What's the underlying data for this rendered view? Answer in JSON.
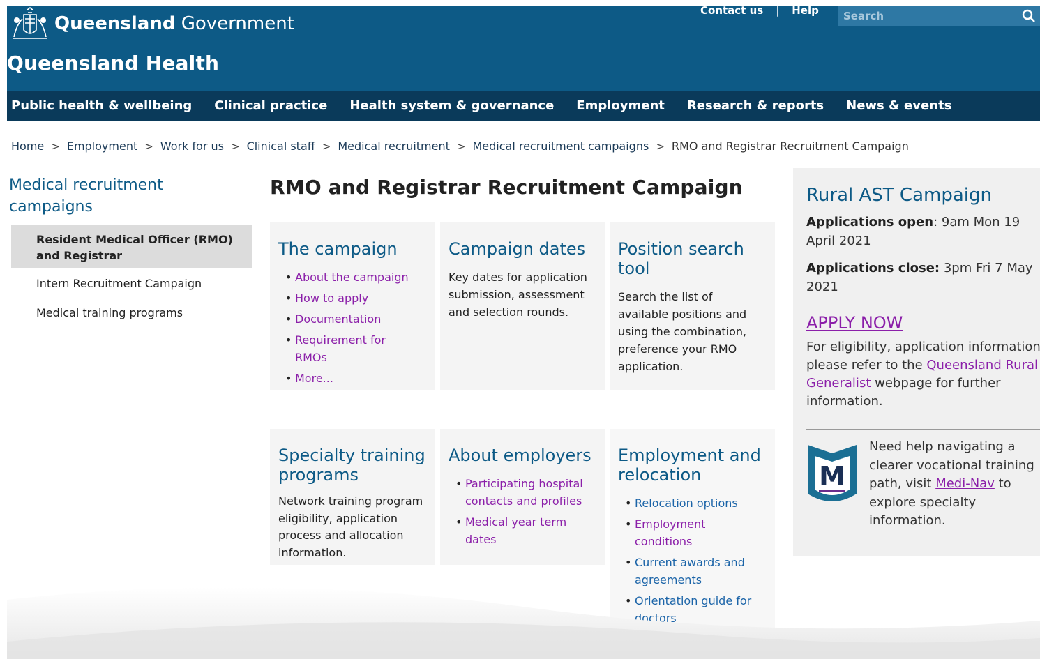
{
  "header": {
    "brand_bold": "Queensland",
    "brand_light": " Government",
    "site_name": "Queensland Health",
    "contact_label": "Contact us",
    "help_label": "Help",
    "search_placeholder": "Search",
    "colors": {
      "header_bg": "#0d5a86",
      "nav_bg": "#0a3a5a"
    }
  },
  "nav": {
    "items": [
      "Public health & wellbeing",
      "Clinical practice",
      "Health system & governance",
      "Employment",
      "Research & reports",
      "News & events"
    ]
  },
  "breadcrumb": {
    "items": [
      "Home",
      "Employment",
      "Work for us",
      "Clinical staff",
      "Medical recruitment",
      "Medical recruitment campaigns"
    ],
    "current": "RMO and Registrar Recruitment Campaign"
  },
  "sidenav": {
    "title": "Medical recruitment campaigns",
    "items": [
      "Resident Medical Officer (RMO) and Registrar",
      "Intern Recruitment Campaign",
      "Medical training programs"
    ]
  },
  "main": {
    "title": "RMO and Registrar Recruitment Campaign",
    "tiles": {
      "campaign": {
        "title": "The campaign",
        "links": [
          "About the campaign",
          "How to apply",
          "Documentation",
          "Requirement for RMOs",
          "More..."
        ]
      },
      "dates": {
        "title": "Campaign dates",
        "text": "Key dates for application submission, assessment and selection rounds."
      },
      "position": {
        "title": "Position search tool",
        "text": "Search the list of available positions and using the combination, preference your RMO application."
      },
      "specialty": {
        "title": "Specialty training programs",
        "text": "Network training program eligibility, application process and allocation information."
      },
      "employers": {
        "title": "About employers",
        "links": [
          "Participating hospital contacts and profiles",
          "Medical year term dates"
        ]
      },
      "relocation": {
        "title": "Employment and relocation",
        "links": [
          "Relocation options",
          "Employment conditions",
          "Current awards and agreements",
          "Orientation guide for doctors"
        ]
      }
    }
  },
  "aside": {
    "title": "Rural AST Campaign",
    "open_label": "Applications open",
    "open_value": ": 9am Mon 19 April 2021",
    "close_label": "Applications close:",
    "close_value": " 3pm Fri 7 May 2021",
    "apply_label": "APPLY NOW",
    "elig_before": "For eligibility, application information please refer to the ",
    "elig_link": "Queensland Rural Generalist",
    "elig_after": " webpage for further information.",
    "medinav_before": "Need help navigating a clearer vocational training path, visit ",
    "medinav_link": "Medi-Nav",
    "medinav_after": " to explore specialty information.",
    "medinav_logo_letter": "M"
  }
}
